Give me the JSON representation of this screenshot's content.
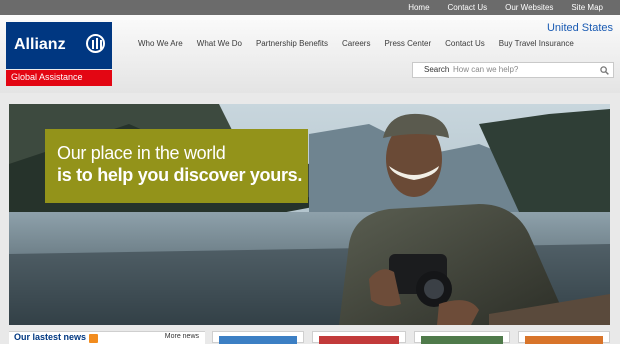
{
  "top_links": [
    "Home",
    "Contact Us",
    "Our Websites",
    "Site Map"
  ],
  "logo": {
    "brand": "Allianz",
    "division": "Global Assistance"
  },
  "country": "United States",
  "nav": [
    "Who We Are",
    "What We Do",
    "Partnership Benefits",
    "Careers",
    "Press Center",
    "Contact Us",
    "Buy Travel Insurance"
  ],
  "search": {
    "label": "Search",
    "placeholder": "How can we help?"
  },
  "hero": {
    "line1": "Our place in the world",
    "line2": "is to help you discover yours."
  },
  "news": {
    "title": "Our lastest news",
    "more": "More news"
  },
  "colors": {
    "brand_blue": "#003781",
    "brand_red": "#e30613",
    "promo_olive": "#93931a",
    "link_blue": "#1a5bb3"
  }
}
